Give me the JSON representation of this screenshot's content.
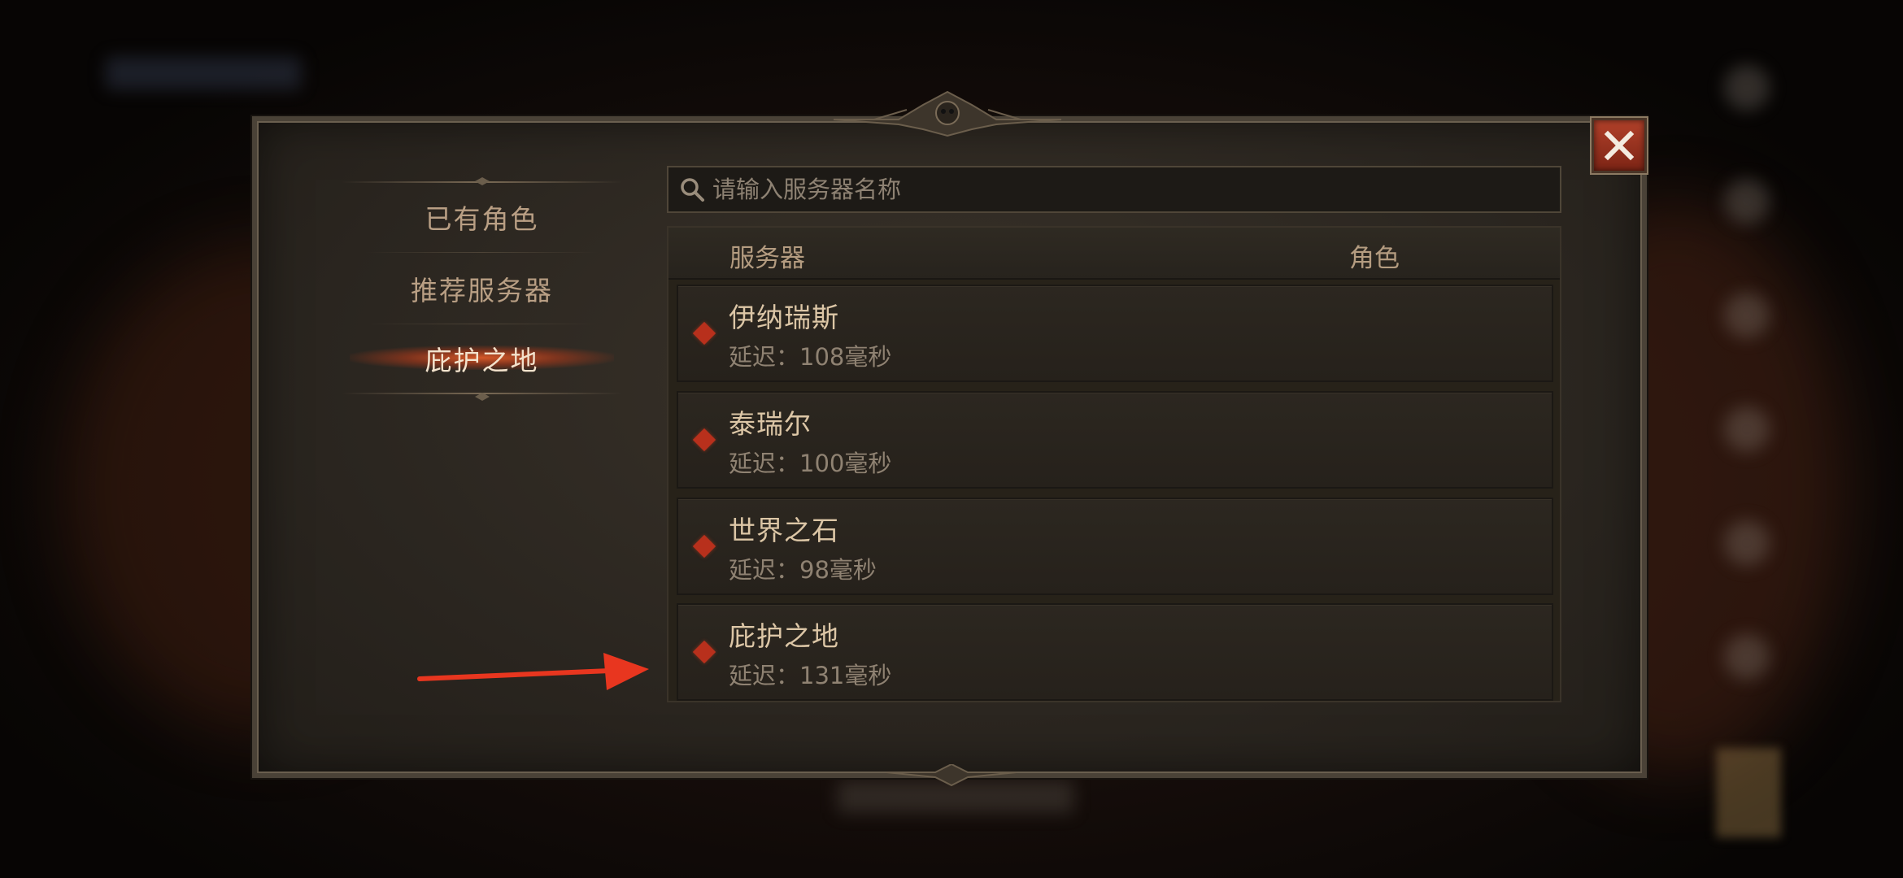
{
  "search": {
    "placeholder": "请输入服务器名称"
  },
  "nav": {
    "items": [
      {
        "label": "已有角色",
        "active": false
      },
      {
        "label": "推荐服务器",
        "active": false
      },
      {
        "label": "庇护之地",
        "active": true
      }
    ]
  },
  "table": {
    "headers": {
      "server": "服务器",
      "character": "角色"
    },
    "rows": [
      {
        "name": "伊纳瑞斯",
        "latency": "延迟：108毫秒"
      },
      {
        "name": "泰瑞尔",
        "latency": "延迟：100毫秒"
      },
      {
        "name": "世界之石",
        "latency": "延迟：98毫秒"
      },
      {
        "name": "庇护之地",
        "latency": "延迟：131毫秒"
      }
    ]
  },
  "colors": {
    "accent_red": "#b8301c",
    "annotation_arrow": "#e8361f",
    "text_gold": "#dcc6a6",
    "text_muted": "#8f8272"
  },
  "icons": {
    "close": "close-icon",
    "search": "search-icon",
    "row_marker": "diamond-marker-icon"
  }
}
